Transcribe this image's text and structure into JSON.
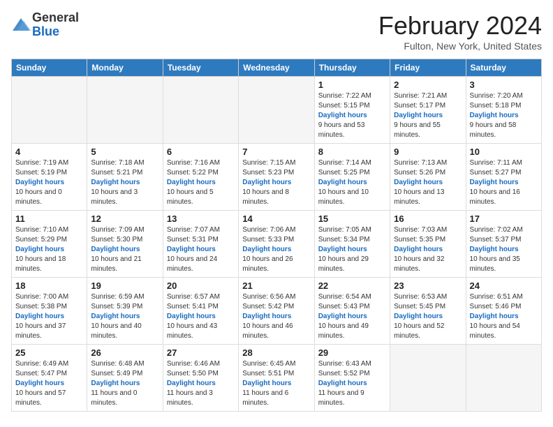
{
  "header": {
    "logo_general": "General",
    "logo_blue": "Blue",
    "month_title": "February 2024",
    "location": "Fulton, New York, United States"
  },
  "columns": [
    "Sunday",
    "Monday",
    "Tuesday",
    "Wednesday",
    "Thursday",
    "Friday",
    "Saturday"
  ],
  "weeks": [
    [
      {
        "day": "",
        "sunrise": "",
        "sunset": "",
        "daylight": ""
      },
      {
        "day": "",
        "sunrise": "",
        "sunset": "",
        "daylight": ""
      },
      {
        "day": "",
        "sunrise": "",
        "sunset": "",
        "daylight": ""
      },
      {
        "day": "",
        "sunrise": "",
        "sunset": "",
        "daylight": ""
      },
      {
        "day": "1",
        "sunrise": "Sunrise: 7:22 AM",
        "sunset": "Sunset: 5:15 PM",
        "daylight": "Daylight: 9 hours and 53 minutes."
      },
      {
        "day": "2",
        "sunrise": "Sunrise: 7:21 AM",
        "sunset": "Sunset: 5:17 PM",
        "daylight": "Daylight: 9 hours and 55 minutes."
      },
      {
        "day": "3",
        "sunrise": "Sunrise: 7:20 AM",
        "sunset": "Sunset: 5:18 PM",
        "daylight": "Daylight: 9 hours and 58 minutes."
      }
    ],
    [
      {
        "day": "4",
        "sunrise": "Sunrise: 7:19 AM",
        "sunset": "Sunset: 5:19 PM",
        "daylight": "Daylight: 10 hours and 0 minutes."
      },
      {
        "day": "5",
        "sunrise": "Sunrise: 7:18 AM",
        "sunset": "Sunset: 5:21 PM",
        "daylight": "Daylight: 10 hours and 3 minutes."
      },
      {
        "day": "6",
        "sunrise": "Sunrise: 7:16 AM",
        "sunset": "Sunset: 5:22 PM",
        "daylight": "Daylight: 10 hours and 5 minutes."
      },
      {
        "day": "7",
        "sunrise": "Sunrise: 7:15 AM",
        "sunset": "Sunset: 5:23 PM",
        "daylight": "Daylight: 10 hours and 8 minutes."
      },
      {
        "day": "8",
        "sunrise": "Sunrise: 7:14 AM",
        "sunset": "Sunset: 5:25 PM",
        "daylight": "Daylight: 10 hours and 10 minutes."
      },
      {
        "day": "9",
        "sunrise": "Sunrise: 7:13 AM",
        "sunset": "Sunset: 5:26 PM",
        "daylight": "Daylight: 10 hours and 13 minutes."
      },
      {
        "day": "10",
        "sunrise": "Sunrise: 7:11 AM",
        "sunset": "Sunset: 5:27 PM",
        "daylight": "Daylight: 10 hours and 16 minutes."
      }
    ],
    [
      {
        "day": "11",
        "sunrise": "Sunrise: 7:10 AM",
        "sunset": "Sunset: 5:29 PM",
        "daylight": "Daylight: 10 hours and 18 minutes."
      },
      {
        "day": "12",
        "sunrise": "Sunrise: 7:09 AM",
        "sunset": "Sunset: 5:30 PM",
        "daylight": "Daylight: 10 hours and 21 minutes."
      },
      {
        "day": "13",
        "sunrise": "Sunrise: 7:07 AM",
        "sunset": "Sunset: 5:31 PM",
        "daylight": "Daylight: 10 hours and 24 minutes."
      },
      {
        "day": "14",
        "sunrise": "Sunrise: 7:06 AM",
        "sunset": "Sunset: 5:33 PM",
        "daylight": "Daylight: 10 hours and 26 minutes."
      },
      {
        "day": "15",
        "sunrise": "Sunrise: 7:05 AM",
        "sunset": "Sunset: 5:34 PM",
        "daylight": "Daylight: 10 hours and 29 minutes."
      },
      {
        "day": "16",
        "sunrise": "Sunrise: 7:03 AM",
        "sunset": "Sunset: 5:35 PM",
        "daylight": "Daylight: 10 hours and 32 minutes."
      },
      {
        "day": "17",
        "sunrise": "Sunrise: 7:02 AM",
        "sunset": "Sunset: 5:37 PM",
        "daylight": "Daylight: 10 hours and 35 minutes."
      }
    ],
    [
      {
        "day": "18",
        "sunrise": "Sunrise: 7:00 AM",
        "sunset": "Sunset: 5:38 PM",
        "daylight": "Daylight: 10 hours and 37 minutes."
      },
      {
        "day": "19",
        "sunrise": "Sunrise: 6:59 AM",
        "sunset": "Sunset: 5:39 PM",
        "daylight": "Daylight: 10 hours and 40 minutes."
      },
      {
        "day": "20",
        "sunrise": "Sunrise: 6:57 AM",
        "sunset": "Sunset: 5:41 PM",
        "daylight": "Daylight: 10 hours and 43 minutes."
      },
      {
        "day": "21",
        "sunrise": "Sunrise: 6:56 AM",
        "sunset": "Sunset: 5:42 PM",
        "daylight": "Daylight: 10 hours and 46 minutes."
      },
      {
        "day": "22",
        "sunrise": "Sunrise: 6:54 AM",
        "sunset": "Sunset: 5:43 PM",
        "daylight": "Daylight: 10 hours and 49 minutes."
      },
      {
        "day": "23",
        "sunrise": "Sunrise: 6:53 AM",
        "sunset": "Sunset: 5:45 PM",
        "daylight": "Daylight: 10 hours and 52 minutes."
      },
      {
        "day": "24",
        "sunrise": "Sunrise: 6:51 AM",
        "sunset": "Sunset: 5:46 PM",
        "daylight": "Daylight: 10 hours and 54 minutes."
      }
    ],
    [
      {
        "day": "25",
        "sunrise": "Sunrise: 6:49 AM",
        "sunset": "Sunset: 5:47 PM",
        "daylight": "Daylight: 10 hours and 57 minutes."
      },
      {
        "day": "26",
        "sunrise": "Sunrise: 6:48 AM",
        "sunset": "Sunset: 5:49 PM",
        "daylight": "Daylight: 11 hours and 0 minutes."
      },
      {
        "day": "27",
        "sunrise": "Sunrise: 6:46 AM",
        "sunset": "Sunset: 5:50 PM",
        "daylight": "Daylight: 11 hours and 3 minutes."
      },
      {
        "day": "28",
        "sunrise": "Sunrise: 6:45 AM",
        "sunset": "Sunset: 5:51 PM",
        "daylight": "Daylight: 11 hours and 6 minutes."
      },
      {
        "day": "29",
        "sunrise": "Sunrise: 6:43 AM",
        "sunset": "Sunset: 5:52 PM",
        "daylight": "Daylight: 11 hours and 9 minutes."
      },
      {
        "day": "",
        "sunrise": "",
        "sunset": "",
        "daylight": ""
      },
      {
        "day": "",
        "sunrise": "",
        "sunset": "",
        "daylight": ""
      }
    ]
  ]
}
